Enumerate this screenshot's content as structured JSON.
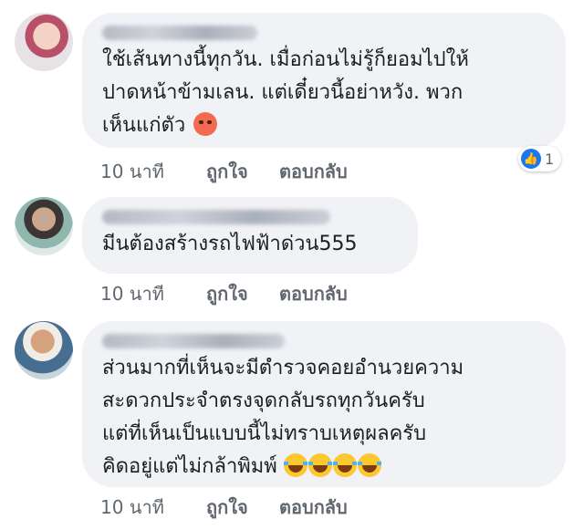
{
  "comments": [
    {
      "text_lines": [
        "ใช้เส้นทางนี้ทุกวัน. เมื่อก่อนไม่รู้ก็ยอมไปให้",
        "ปาดหน้าข้ามเลน. แต่เดี๋ยวนี้อย่าหวัง.  พวก",
        "เห็นแก่ตัว"
      ],
      "emoji": "angry-face-icon",
      "time": "10 นาที",
      "like": "ถูกใจ",
      "reply": "ตอบกลับ",
      "reaction_count": "1"
    },
    {
      "text_lines": [
        "มีนต้องสร้างรถไฟฟ้าด่วน555"
      ],
      "time": "10 นาที",
      "like": "ถูกใจ",
      "reply": "ตอบกลับ"
    },
    {
      "text_lines": [
        "ส่วนมากที่เห็นจะมีตำรวจคอยอำนวยความ",
        "สะดวกประจำตรงจุดกลับรถทุกวันครับ",
        "แต่ที่เห็นเป็นแบบนี้ไม่ทราบเหตุผลครับ",
        "คิดอยู่แต่ไม่กล้าพิมพ์"
      ],
      "emoji": "tears-of-joy-icon",
      "emoji_count": 4,
      "time": "10 นาที",
      "like": "ถูกใจ",
      "reply": "ตอบกลับ"
    }
  ],
  "colors": {
    "bubble": "#f1f2f6",
    "text": "#1c1e21",
    "meta": "#606770",
    "like_badge": "#1877f2"
  }
}
